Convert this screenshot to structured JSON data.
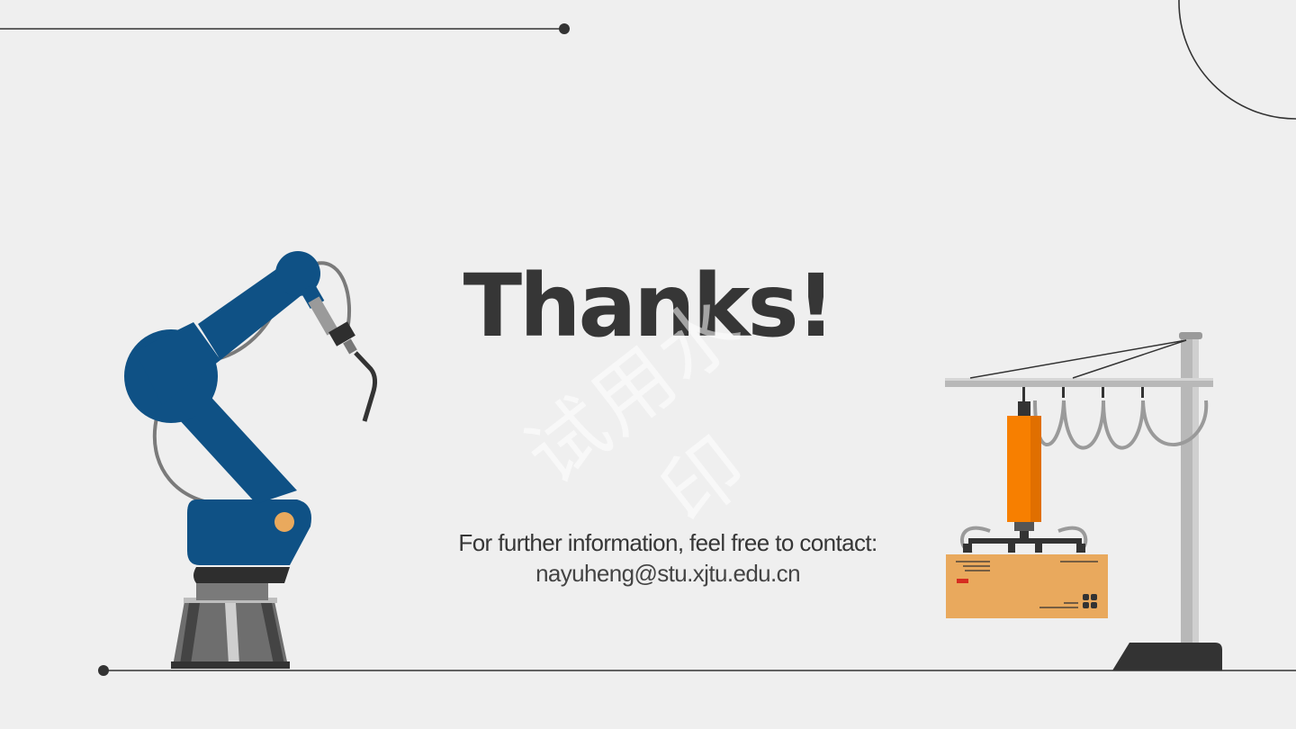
{
  "slide": {
    "title": "Thanks!",
    "watermark": "试用水印",
    "contact_prompt": "For further information, feel free to contact:",
    "contact_email": "nayuheng@stu.xjtu.edu.cn"
  },
  "colors": {
    "background": "#efefef",
    "text": "#363636",
    "robot_blue": "#0f5185",
    "gripper_orange": "#f77f00",
    "box_tan": "#e9a95d",
    "line_dark": "#333333"
  },
  "illustrations": {
    "left": "robot-arm-welder-icon",
    "right": "crane-gripper-with-box-icon"
  }
}
